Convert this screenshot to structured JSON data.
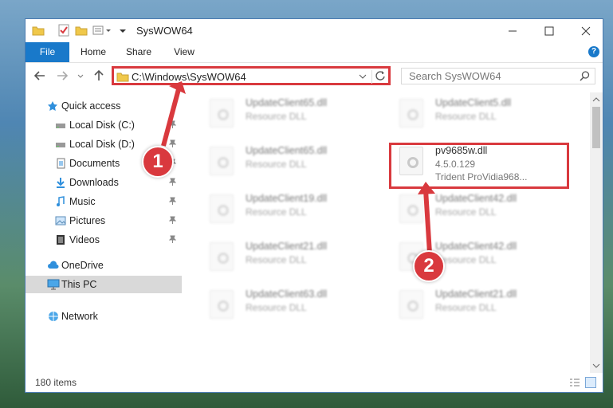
{
  "window": {
    "title": "SysWOW64"
  },
  "ribbon": {
    "tabs": [
      "File",
      "Home",
      "Share",
      "View"
    ],
    "help_label": "?"
  },
  "navigation": {
    "address_path": "C:\\Windows\\SysWOW64",
    "search_placeholder": "Search SysWOW64"
  },
  "sidebar": {
    "items": [
      {
        "label": "Quick access",
        "icon": "star-icon"
      },
      {
        "label": "Local Disk (C:)",
        "icon": "drive-icon",
        "pinned": true
      },
      {
        "label": "Local Disk (D:)",
        "icon": "drive-icon",
        "pinned": true
      },
      {
        "label": "Documents",
        "icon": "documents-icon",
        "pinned": true
      },
      {
        "label": "Downloads",
        "icon": "download-icon",
        "pinned": true
      },
      {
        "label": "Music",
        "icon": "music-icon",
        "pinned": true
      },
      {
        "label": "Pictures",
        "icon": "pictures-icon",
        "pinned": true
      },
      {
        "label": "Videos",
        "icon": "videos-icon",
        "pinned": true
      },
      {
        "label": "OneDrive",
        "icon": "cloud-icon"
      },
      {
        "label": "This PC",
        "icon": "computer-icon",
        "selected": true
      },
      {
        "label": "Network",
        "icon": "network-icon"
      }
    ]
  },
  "files": [
    {
      "name": "UpdateClient65.dll",
      "desc": "Resource DLL"
    },
    {
      "name": "UpdateClient5.dll",
      "desc": "Resource DLL"
    },
    {
      "name": "UpdateClient65.dll",
      "desc": "Resource DLL"
    },
    {
      "name": "pv9685w.dll",
      "desc": "4.5.0.129",
      "desc2": "Trident ProVidia968..."
    },
    {
      "name": "UpdateClient19.dll",
      "desc": "Resource DLL"
    },
    {
      "name": "UpdateClient42.dll",
      "desc": "Resource DLL"
    },
    {
      "name": "UpdateClient21.dll",
      "desc": "Resource DLL"
    },
    {
      "name": "UpdateClient42.dll",
      "desc": "Resource DLL"
    },
    {
      "name": "UpdateClient63.dll",
      "desc": "Resource DLL"
    },
    {
      "name": "UpdateClient21.dll",
      "desc": "Resource DLL"
    }
  ],
  "status": {
    "item_count": "180 items"
  },
  "annotations": {
    "step1": "1",
    "step2": "2"
  },
  "colors": {
    "accent": "#1979ca",
    "highlight": "#d9393e"
  }
}
